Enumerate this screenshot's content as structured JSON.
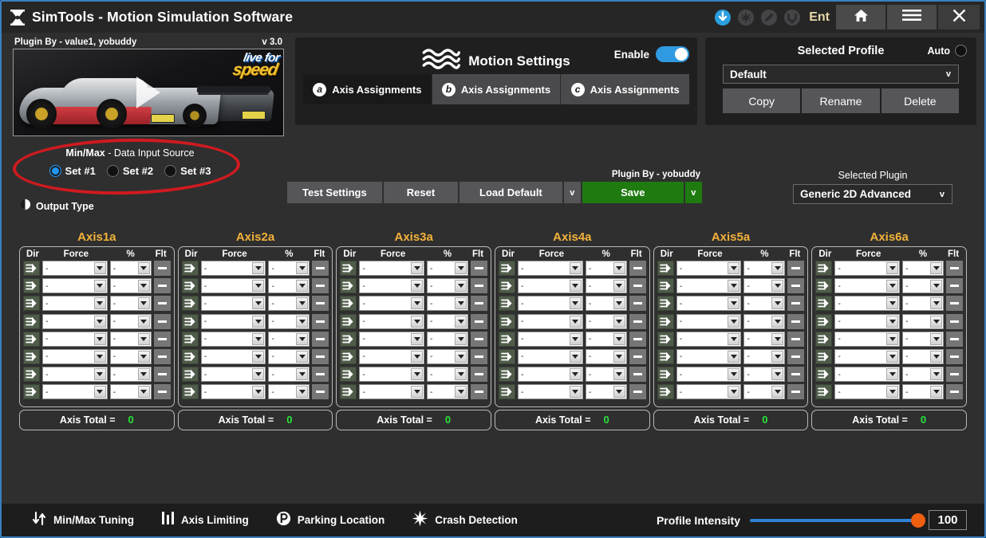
{
  "window": {
    "title": "SimTools - Motion Simulation Software",
    "logo_icon": "simtools-hourglass-icon",
    "ent_label": "Ent",
    "icons": [
      {
        "name": "download-icon",
        "glyph": "download",
        "color": "#2a9fe0",
        "active": true
      },
      {
        "name": "starburst-icon",
        "glyph": "starburst",
        "color": "#4a4a4a",
        "active": false
      },
      {
        "name": "pencil-icon",
        "glyph": "pencil",
        "color": "#4a4a4a",
        "active": false
      },
      {
        "name": "power-plug-icon",
        "glyph": "power",
        "color": "#4a4a4a",
        "active": false
      }
    ],
    "buttons": [
      {
        "name": "home-button",
        "icon": "home-icon"
      },
      {
        "name": "menu-button",
        "icon": "hamburger-icon"
      },
      {
        "name": "close-button",
        "icon": "close-icon"
      }
    ]
  },
  "plugin_preview": {
    "by_label": "Plugin By - value1, yobuddy",
    "version": "v 3.0",
    "game_logo_top": "live for",
    "game_logo_bottom": "speed"
  },
  "minmax_source": {
    "title_strong": "Min/Max",
    "title_rest": " - Data Input Source",
    "options": [
      {
        "label": "Set #1",
        "selected": true
      },
      {
        "label": "Set #2",
        "selected": false
      },
      {
        "label": "Set #3",
        "selected": false
      }
    ],
    "output_type_label": "Output Type",
    "output_type_icon": "half-circle-icon",
    "highlight_color": "#d01a1f"
  },
  "motion_settings": {
    "title": "Motion Settings",
    "wave_icon": "waves-icon",
    "enable_label": "Enable",
    "enable_on": true,
    "tabs": [
      {
        "letter": "a",
        "label": "Axis Assignments",
        "active": true
      },
      {
        "letter": "b",
        "label": "Axis Assignments",
        "active": false
      },
      {
        "letter": "c",
        "label": "Axis Assignments",
        "active": false
      }
    ]
  },
  "selected_profile": {
    "title": "Selected Profile",
    "auto_label": "Auto",
    "auto_on": false,
    "value": "Default",
    "caret": "v",
    "buttons": [
      "Copy",
      "Rename",
      "Delete"
    ]
  },
  "action_bar": {
    "plugin_by": "Plugin By - yobuddy",
    "test_settings": "Test Settings",
    "reset": "Reset",
    "load_default": "Load Default",
    "load_caret": "v",
    "save": "Save",
    "save_caret": "v",
    "save_color": "#1f7a10"
  },
  "selected_plugin": {
    "title": "Selected Plugin",
    "value": "Generic 2D Advanced",
    "caret": "v"
  },
  "axis_grid": {
    "headers": [
      "Dir",
      "Force",
      "%",
      "Flt"
    ],
    "total_label": "Axis Total =",
    "empty_value": "-",
    "rows_per_axis": 8,
    "total_color": "#27e53a",
    "axes": [
      {
        "name": "Axis1a",
        "total": "0"
      },
      {
        "name": "Axis2a",
        "total": "0"
      },
      {
        "name": "Axis3a",
        "total": "0"
      },
      {
        "name": "Axis4a",
        "total": "0"
      },
      {
        "name": "Axis5a",
        "total": "0"
      },
      {
        "name": "Axis6a",
        "total": "0"
      }
    ]
  },
  "bottom_bar": {
    "items": [
      {
        "label": "Min/Max Tuning",
        "icon": "up-down-arrows-icon"
      },
      {
        "label": "Axis Limiting",
        "icon": "bar-levels-icon"
      },
      {
        "label": "Parking Location",
        "icon": "parking-p-icon"
      },
      {
        "label": "Crash Detection",
        "icon": "crash-burst-icon"
      }
    ],
    "intensity_label": "Profile Intensity",
    "intensity_value": "100",
    "intensity_percent": 100,
    "slider_color": "#2f82d4",
    "thumb_color": "#ef5f10"
  }
}
